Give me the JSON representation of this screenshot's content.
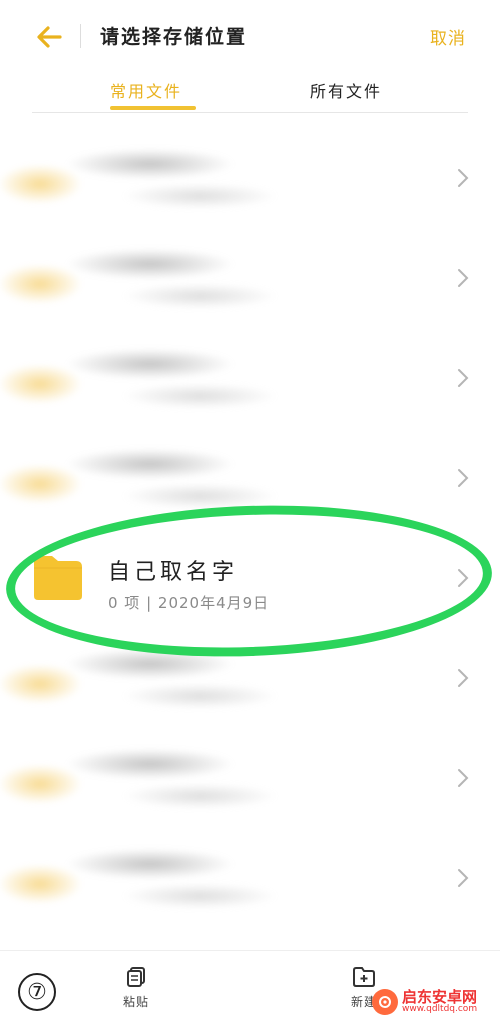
{
  "header": {
    "title": "请选择存储位置",
    "cancel_label": "取消",
    "back_icon": "arrow-left-icon",
    "accent_color": "#e9b21e"
  },
  "tabs": [
    {
      "label": "常用文件",
      "active": true
    },
    {
      "label": "所有文件",
      "active": false
    }
  ],
  "list": {
    "items": [
      {
        "name": "",
        "meta": "",
        "blurred": true
      },
      {
        "name": "",
        "meta": "",
        "blurred": true
      },
      {
        "name": "",
        "meta": "",
        "blurred": true
      },
      {
        "name": "",
        "meta": "",
        "blurred": true
      },
      {
        "name": "自己取名字",
        "meta": "0 项 | 2020年4月9日",
        "blurred": false
      },
      {
        "name": "",
        "meta": "",
        "blurred": true
      },
      {
        "name": "",
        "meta": "",
        "blurred": true
      },
      {
        "name": "",
        "meta": "",
        "blurred": true
      }
    ]
  },
  "bottom_bar": {
    "step_number": "⑦",
    "paste_label": "粘贴",
    "new_folder_label": "新建"
  },
  "watermark": {
    "main": "启东安卓网",
    "sub": "www.qdltdq.com"
  },
  "colors": {
    "folder": "#f5c330",
    "highlight": "#2bd45b"
  }
}
